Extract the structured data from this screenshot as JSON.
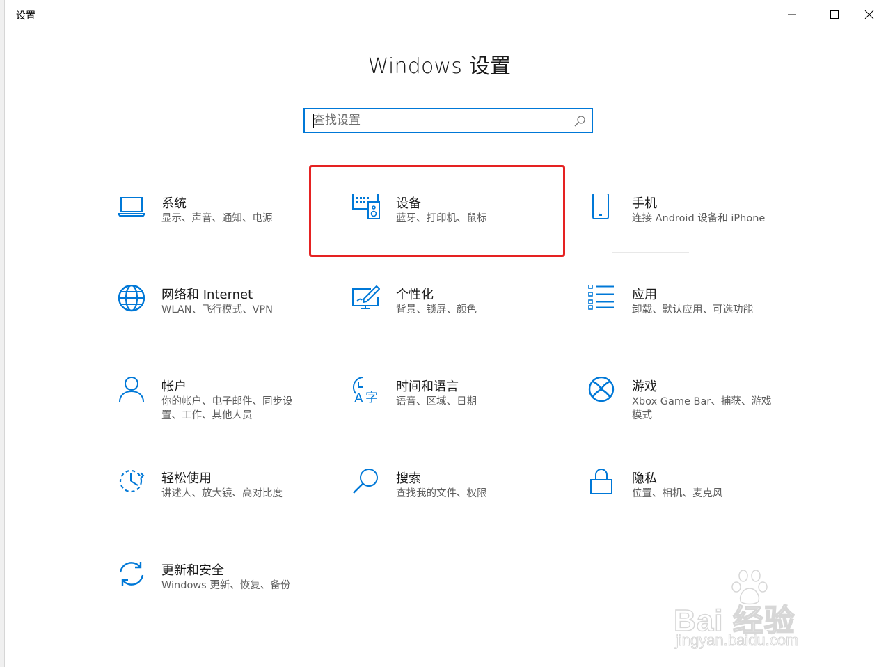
{
  "window": {
    "title": "设置",
    "controls": {
      "minimize": "minimize-icon",
      "maximize": "maximize-icon",
      "close": "close-icon"
    }
  },
  "page": {
    "title": "Windows 设置"
  },
  "search": {
    "placeholder": "查找设置",
    "value": ""
  },
  "accent_color": "#0078d7",
  "highlight_color": "#e52222",
  "tiles": [
    {
      "id": "system",
      "name": "系统",
      "desc": "显示、声音、通知、电源",
      "icon": "laptop-icon"
    },
    {
      "id": "devices",
      "name": "设备",
      "desc": "蓝牙、打印机、鼠标",
      "icon": "devices-icon"
    },
    {
      "id": "phone",
      "name": "手机",
      "desc": "连接 Android 设备和 iPhone",
      "icon": "phone-icon"
    },
    {
      "id": "network",
      "name": "网络和 Internet",
      "desc": "WLAN、飞行模式、VPN",
      "icon": "globe-icon"
    },
    {
      "id": "personalization",
      "name": "个性化",
      "desc": "背景、锁屏、颜色",
      "icon": "paint-icon"
    },
    {
      "id": "apps",
      "name": "应用",
      "desc": "卸载、默认应用、可选功能",
      "icon": "apps-list-icon"
    },
    {
      "id": "accounts",
      "name": "帐户",
      "desc": "你的帐户、电子邮件、同步设置、工作、其他人员",
      "icon": "person-icon"
    },
    {
      "id": "time",
      "name": "时间和语言",
      "desc": "语音、区域、日期",
      "icon": "time-language-icon"
    },
    {
      "id": "gaming",
      "name": "游戏",
      "desc": "Xbox Game Bar、捕获、游戏模式",
      "icon": "xbox-icon"
    },
    {
      "id": "ease",
      "name": "轻松使用",
      "desc": "讲述人、放大镜、高对比度",
      "icon": "ease-of-access-icon"
    },
    {
      "id": "search",
      "name": "搜索",
      "desc": "查找我的文件、权限",
      "icon": "magnifier-icon"
    },
    {
      "id": "privacy",
      "name": "隐私",
      "desc": "位置、相机、麦克风",
      "icon": "lock-icon"
    },
    {
      "id": "update",
      "name": "更新和安全",
      "desc": "Windows 更新、恢复、备份",
      "icon": "sync-icon"
    }
  ],
  "watermark": {
    "main": "Bai 经验",
    "sub": "jingyan.baidu.com",
    "logo": "baidu-paw-icon"
  }
}
